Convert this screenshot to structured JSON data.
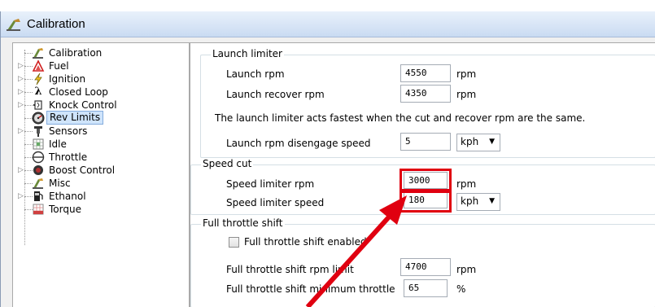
{
  "window": {
    "title": "Calibration",
    "title_icon": "calibration-icon",
    "title_gradient_top": "#e9f1fb",
    "title_gradient_bottom": "#c9dbf2"
  },
  "tree": {
    "items": [
      {
        "label": "Calibration",
        "icon": "calibration-icon",
        "expander": false,
        "selected": false
      },
      {
        "label": "Fuel",
        "icon": "fuel-icon",
        "expander": true,
        "selected": false
      },
      {
        "label": "Ignition",
        "icon": "ignition-icon",
        "expander": true,
        "selected": false
      },
      {
        "label": "Closed Loop",
        "icon": "lambda-icon",
        "expander": true,
        "selected": false
      },
      {
        "label": "Knock Control",
        "icon": "knock-icon",
        "expander": true,
        "selected": false
      },
      {
        "label": "Rev Limits",
        "icon": "rev-limits-icon",
        "expander": false,
        "selected": true
      },
      {
        "label": "Sensors",
        "icon": "sensors-icon",
        "expander": true,
        "selected": false
      },
      {
        "label": "Idle",
        "icon": "idle-icon",
        "expander": false,
        "selected": false
      },
      {
        "label": "Throttle",
        "icon": "throttle-icon",
        "expander": false,
        "selected": false
      },
      {
        "label": "Boost Control",
        "icon": "boost-icon",
        "expander": true,
        "selected": false
      },
      {
        "label": "Misc",
        "icon": "misc-icon",
        "expander": false,
        "selected": false
      },
      {
        "label": "Ethanol",
        "icon": "fuel-pump-icon",
        "expander": true,
        "selected": false
      },
      {
        "label": "Torque",
        "icon": "torque-icon",
        "expander": false,
        "selected": false
      }
    ],
    "selection_color": "#cfe4fb"
  },
  "launch_limiter": {
    "group_title": "Launch limiter",
    "launch_rpm_label": "Launch rpm",
    "launch_rpm_value": "4550",
    "launch_rpm_unit": "rpm",
    "recover_rpm_label": "Launch recover rpm",
    "recover_rpm_value": "4350",
    "recover_rpm_unit": "rpm",
    "note": "The launch limiter acts fastest when the cut and recover rpm are the same.",
    "disengage_label": "Launch rpm disengage speed",
    "disengage_value": "5",
    "disengage_unit": "kph"
  },
  "speed_cut": {
    "group_title": "Speed cut",
    "rpm_label": "Speed limiter rpm",
    "rpm_value": "3000",
    "rpm_unit": "rpm",
    "speed_label": "Speed limiter speed",
    "speed_value": "180",
    "speed_unit": "kph"
  },
  "full_throttle_shift": {
    "group_title": "Full throttle shift",
    "enabled_label": "Full throttle shift enabled",
    "enabled_checked": false,
    "rpm_limit_label": "Full throttle shift rpm limit",
    "rpm_limit_value": "4700",
    "rpm_limit_unit": "rpm",
    "min_throttle_label": "Full throttle shift minimum throttle",
    "min_throttle_value": "65",
    "min_throttle_unit": "%"
  },
  "annotation": {
    "highlight_color": "#e00010"
  }
}
